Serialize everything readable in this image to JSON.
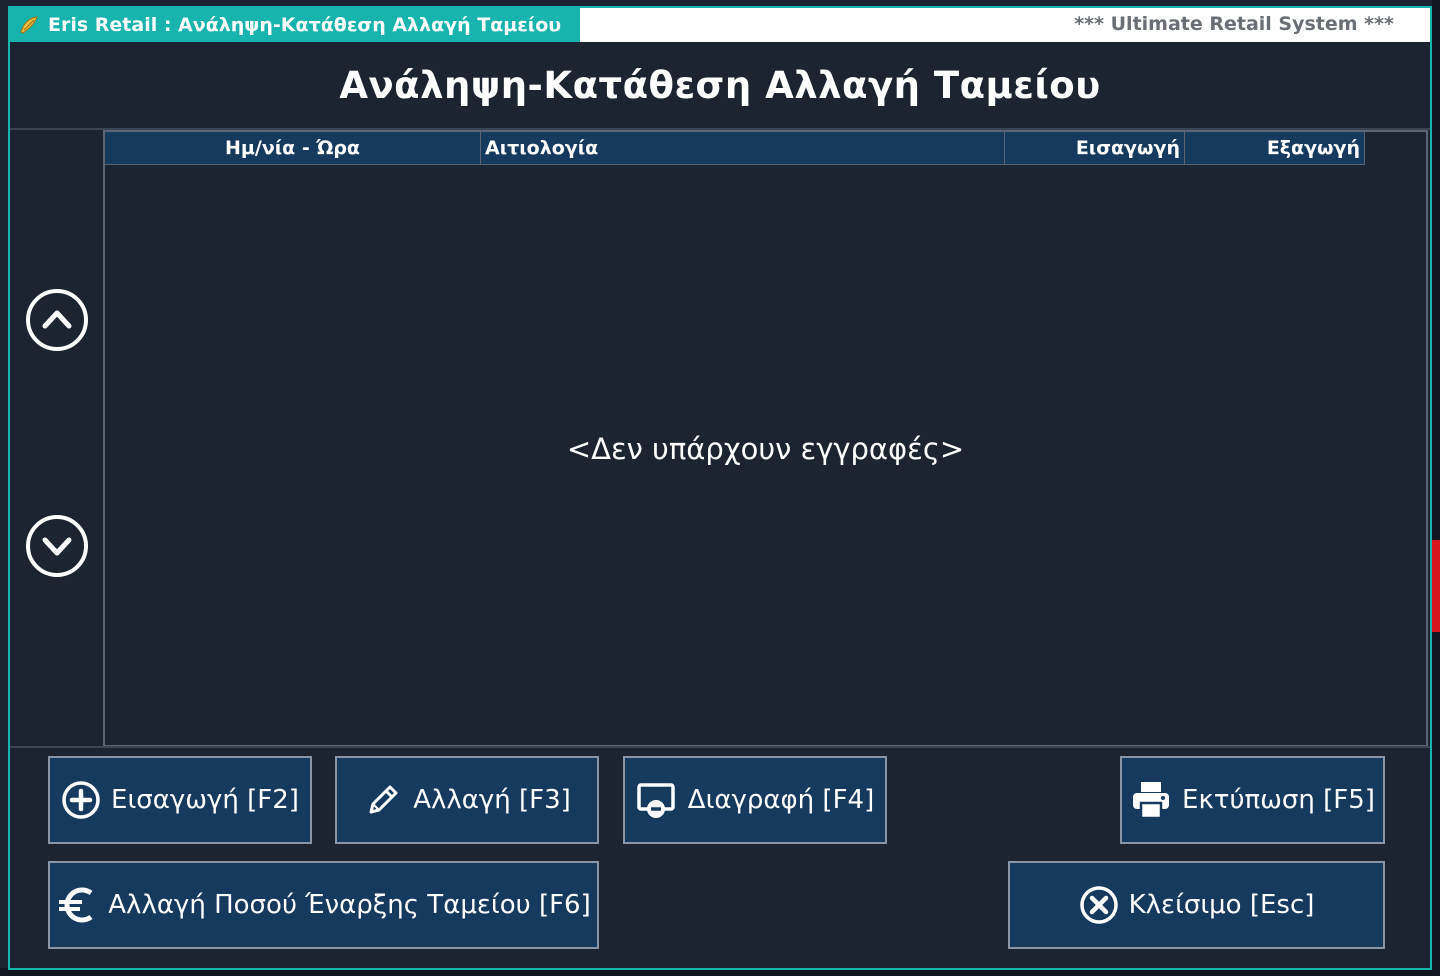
{
  "window": {
    "title": "Eris Retail : Ανάληψη-Κατάθεση Αλλαγή Ταμείου",
    "system_label": "*** Ultimate Retail System ***",
    "app_icon": "app-logo-icon"
  },
  "header": {
    "title": "Ανάληψη-Κατάθεση Αλλαγή Ταμείου"
  },
  "nav": {
    "up_icon": "chevron-up-circle-icon",
    "down_icon": "chevron-down-circle-icon"
  },
  "grid": {
    "columns": [
      "Ημ/νία - Ώρα",
      "Αιτιολογία",
      "Εισαγωγή",
      "Εξαγωγή"
    ],
    "rows": [],
    "empty_text": "<Δεν υπάρχουν εγγραφές>"
  },
  "buttons": {
    "insert": {
      "label": "Εισαγωγή [F2]",
      "icon": "plus-circle-icon"
    },
    "edit": {
      "label": "Αλλαγή [F3]",
      "icon": "pencil-icon"
    },
    "delete": {
      "label": "Διαγραφή [F4]",
      "icon": "screen-minus-icon"
    },
    "print": {
      "label": "Εκτύπωση [F5]",
      "icon": "printer-icon"
    },
    "change_amount": {
      "label": "Αλλαγή Ποσού Έναρξης Ταμείου [F6]",
      "icon": "euro-icon"
    },
    "close": {
      "label": "Κλείσιμο [Esc]",
      "icon": "close-circle-icon"
    }
  },
  "colors": {
    "accent": "#17b3ad",
    "background": "#1c2431",
    "button": "#153a5e",
    "alert": "#d8141c"
  }
}
